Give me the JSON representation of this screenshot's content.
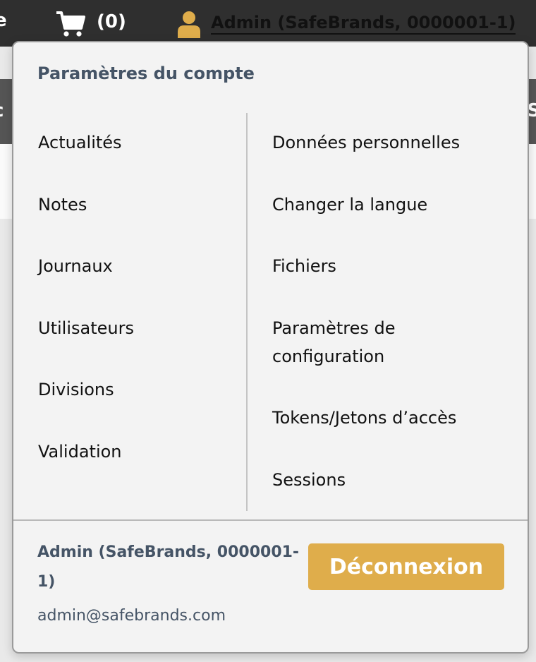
{
  "topbar": {
    "left_fragment": "e",
    "cart_icon": "cart-icon",
    "cart_count": "(0)",
    "user_icon": "user-icon",
    "user_label": "Admin (SafeBrands, 0000001-1)"
  },
  "background": {
    "left_fragment": "c",
    "right_fragment": "S"
  },
  "menu": {
    "title": "Paramètres du compte",
    "left_items": [
      "Actualités",
      "Notes",
      "Journaux",
      "Utilisateurs",
      "Divisions",
      "Validation"
    ],
    "right_items": [
      "Données personnelles",
      "Changer la langue",
      "Fichiers",
      "Paramètres de configuration",
      "Tokens/Jetons d’accès",
      "Sessions"
    ]
  },
  "footer": {
    "user_name": "Admin (SafeBrands, 0000001-1)",
    "email": "admin@safebrands.com",
    "logout_label": "Déconnexion"
  },
  "colors": {
    "topbar": "#2f2f2f",
    "accent": "#dfad4b",
    "heading_text": "#455466",
    "panel_bg": "#f3f3f3"
  }
}
